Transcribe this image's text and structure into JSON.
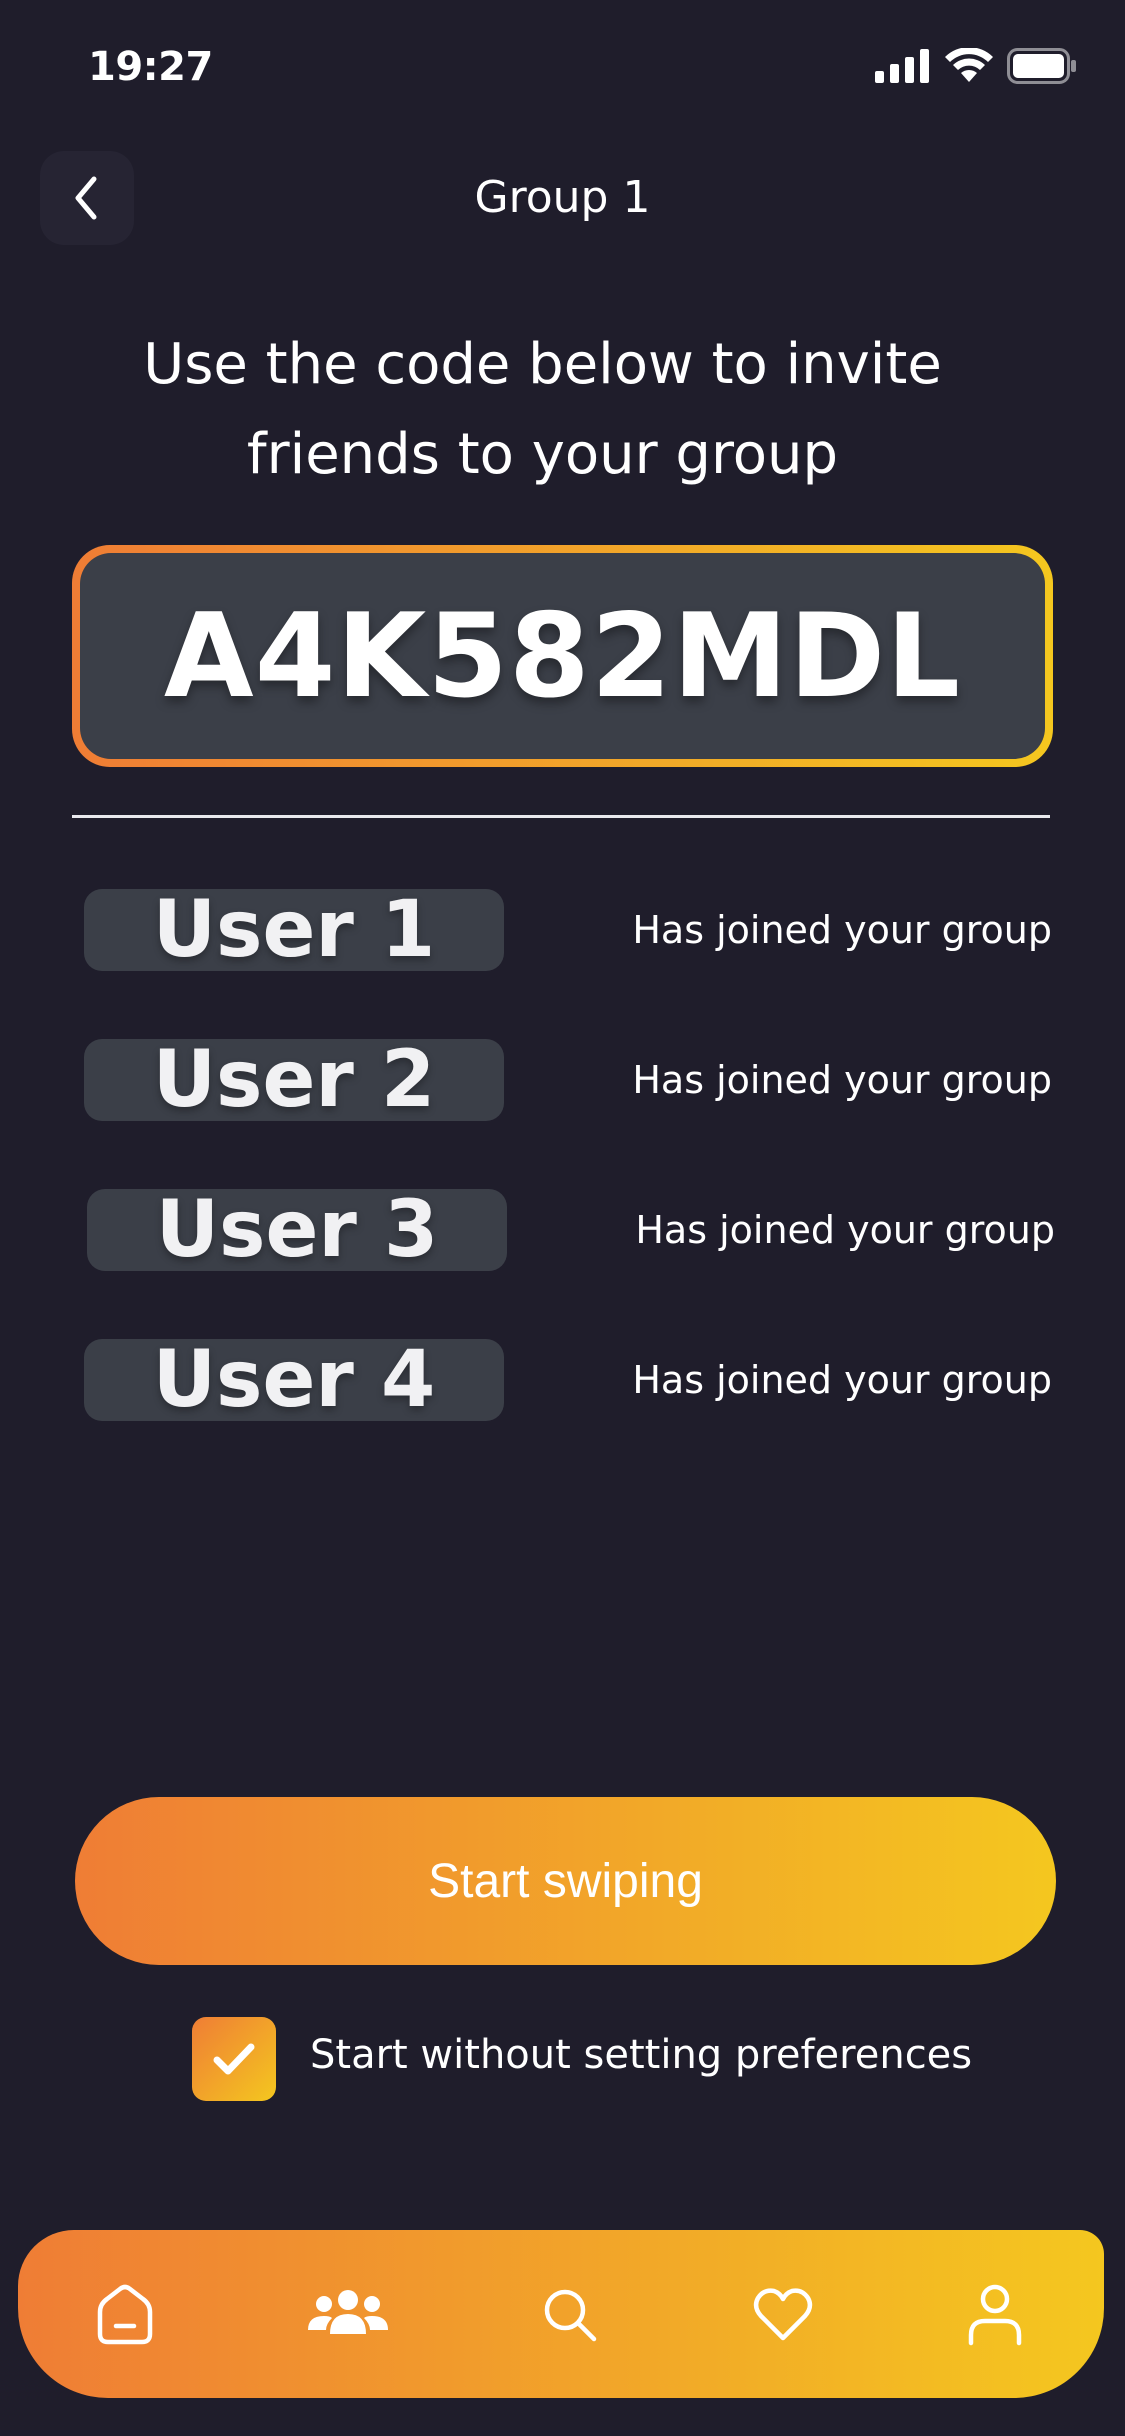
{
  "status_bar": {
    "time": "19:27"
  },
  "header": {
    "title": "Group 1",
    "back_icon": "chevron-left-icon"
  },
  "instruction": "Use the code below to invite friends to your group",
  "invite_code": "A4K582MDL",
  "members": [
    {
      "name": "User 1",
      "status": "Has joined your group"
    },
    {
      "name": "User 2",
      "status": "Has joined your group"
    },
    {
      "name": "User 3",
      "status": "Has joined your group"
    },
    {
      "name": "User 4",
      "status": "Has joined your group"
    }
  ],
  "actions": {
    "start_label": "Start swiping",
    "skip_preferences_label": "Start without setting preferences",
    "skip_preferences_checked": true
  },
  "bottom_nav": [
    {
      "icon": "home-icon"
    },
    {
      "icon": "group-icon"
    },
    {
      "icon": "search-icon"
    },
    {
      "icon": "heart-icon"
    },
    {
      "icon": "profile-icon"
    }
  ],
  "colors": {
    "background": "#1f1d2b",
    "accent_start": "#ef7d35",
    "accent_end": "#f4c71f",
    "pill": "#3b3f48"
  }
}
